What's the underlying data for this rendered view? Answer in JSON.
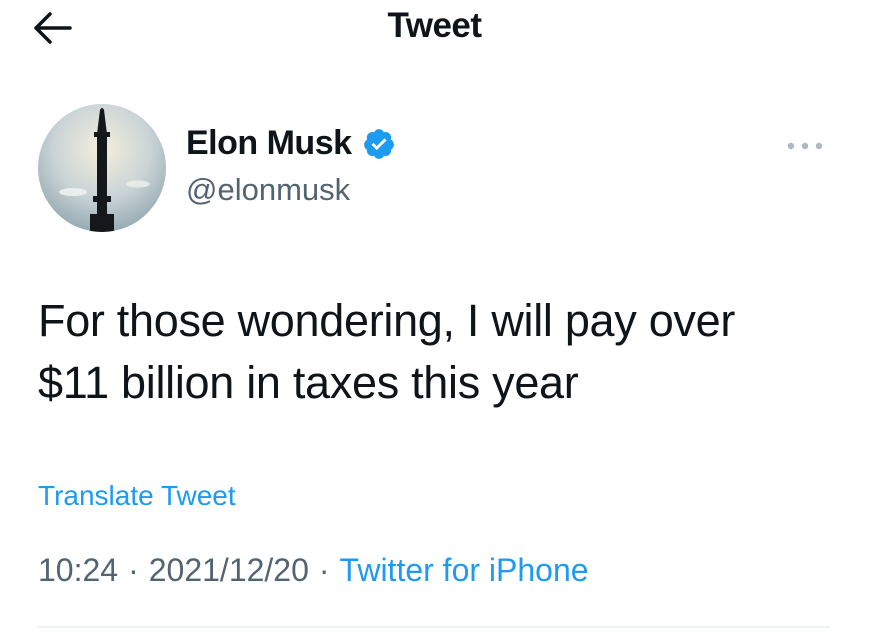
{
  "header": {
    "title": "Tweet",
    "back_icon": "arrow-left-icon"
  },
  "author": {
    "name": "Elon Musk",
    "handle": "@elonmusk",
    "verified": true,
    "verified_icon": "verified-badge-icon",
    "avatar_icon": "starship-avatar-icon"
  },
  "more_menu": {
    "icon": "more-dots-icon"
  },
  "tweet": {
    "line1": "For those wondering, I will pay over",
    "line2": "$11 billion in taxes this year",
    "translate_label": "Translate Tweet"
  },
  "meta": {
    "time": "10:24",
    "separator": "·",
    "date": "2021/12/20",
    "source": "Twitter for iPhone"
  },
  "colors": {
    "accent": "#1d9bf0",
    "text": "#0f1419",
    "muted": "#536471"
  }
}
